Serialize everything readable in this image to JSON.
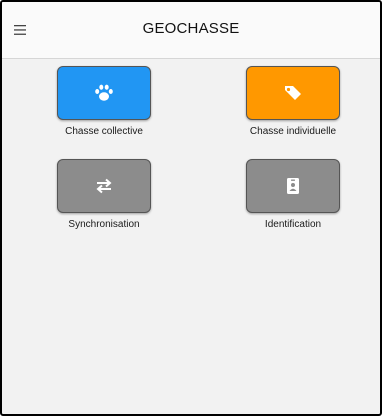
{
  "app": {
    "title": "GEOCHASSE",
    "menu_icon": "hamburger-menu-icon"
  },
  "tiles": [
    {
      "label": "Chasse collective",
      "icon": "paw-icon",
      "color": "#2196F3"
    },
    {
      "label": "Chasse individuelle",
      "icon": "tag-icon",
      "color": "#FF9800"
    },
    {
      "label": "Synchronisation",
      "icon": "swap-arrows-icon",
      "color": "#8C8C8C"
    },
    {
      "label": "Identification",
      "icon": "id-badge-icon",
      "color": "#8C8C8C"
    }
  ]
}
